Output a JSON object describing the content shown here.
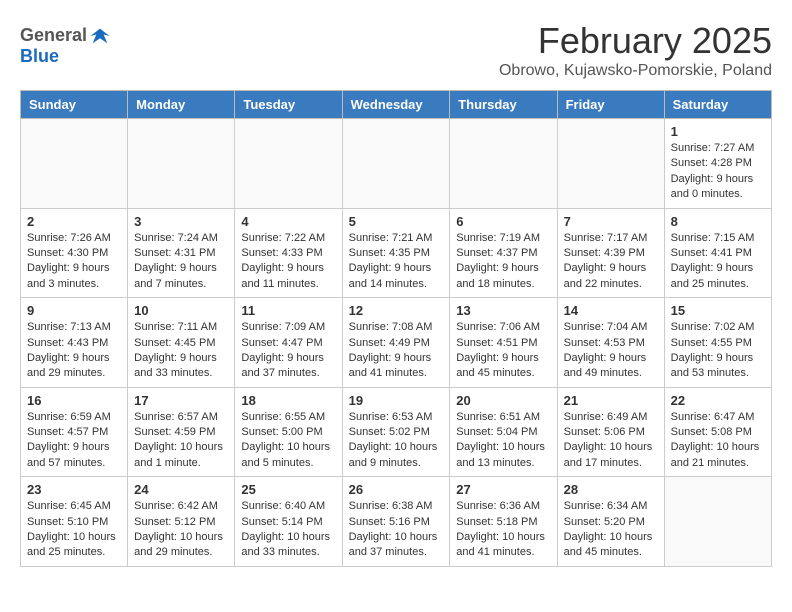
{
  "header": {
    "logo_general": "General",
    "logo_blue": "Blue",
    "title": "February 2025",
    "subtitle": "Obrowo, Kujawsko-Pomorskie, Poland"
  },
  "weekdays": [
    "Sunday",
    "Monday",
    "Tuesday",
    "Wednesday",
    "Thursday",
    "Friday",
    "Saturday"
  ],
  "weeks": [
    [
      {
        "day": "",
        "detail": ""
      },
      {
        "day": "",
        "detail": ""
      },
      {
        "day": "",
        "detail": ""
      },
      {
        "day": "",
        "detail": ""
      },
      {
        "day": "",
        "detail": ""
      },
      {
        "day": "",
        "detail": ""
      },
      {
        "day": "1",
        "detail": "Sunrise: 7:27 AM\nSunset: 4:28 PM\nDaylight: 9 hours and 0 minutes."
      }
    ],
    [
      {
        "day": "2",
        "detail": "Sunrise: 7:26 AM\nSunset: 4:30 PM\nDaylight: 9 hours and 3 minutes."
      },
      {
        "day": "3",
        "detail": "Sunrise: 7:24 AM\nSunset: 4:31 PM\nDaylight: 9 hours and 7 minutes."
      },
      {
        "day": "4",
        "detail": "Sunrise: 7:22 AM\nSunset: 4:33 PM\nDaylight: 9 hours and 11 minutes."
      },
      {
        "day": "5",
        "detail": "Sunrise: 7:21 AM\nSunset: 4:35 PM\nDaylight: 9 hours and 14 minutes."
      },
      {
        "day": "6",
        "detail": "Sunrise: 7:19 AM\nSunset: 4:37 PM\nDaylight: 9 hours and 18 minutes."
      },
      {
        "day": "7",
        "detail": "Sunrise: 7:17 AM\nSunset: 4:39 PM\nDaylight: 9 hours and 22 minutes."
      },
      {
        "day": "8",
        "detail": "Sunrise: 7:15 AM\nSunset: 4:41 PM\nDaylight: 9 hours and 25 minutes."
      }
    ],
    [
      {
        "day": "9",
        "detail": "Sunrise: 7:13 AM\nSunset: 4:43 PM\nDaylight: 9 hours and 29 minutes."
      },
      {
        "day": "10",
        "detail": "Sunrise: 7:11 AM\nSunset: 4:45 PM\nDaylight: 9 hours and 33 minutes."
      },
      {
        "day": "11",
        "detail": "Sunrise: 7:09 AM\nSunset: 4:47 PM\nDaylight: 9 hours and 37 minutes."
      },
      {
        "day": "12",
        "detail": "Sunrise: 7:08 AM\nSunset: 4:49 PM\nDaylight: 9 hours and 41 minutes."
      },
      {
        "day": "13",
        "detail": "Sunrise: 7:06 AM\nSunset: 4:51 PM\nDaylight: 9 hours and 45 minutes."
      },
      {
        "day": "14",
        "detail": "Sunrise: 7:04 AM\nSunset: 4:53 PM\nDaylight: 9 hours and 49 minutes."
      },
      {
        "day": "15",
        "detail": "Sunrise: 7:02 AM\nSunset: 4:55 PM\nDaylight: 9 hours and 53 minutes."
      }
    ],
    [
      {
        "day": "16",
        "detail": "Sunrise: 6:59 AM\nSunset: 4:57 PM\nDaylight: 9 hours and 57 minutes."
      },
      {
        "day": "17",
        "detail": "Sunrise: 6:57 AM\nSunset: 4:59 PM\nDaylight: 10 hours and 1 minute."
      },
      {
        "day": "18",
        "detail": "Sunrise: 6:55 AM\nSunset: 5:00 PM\nDaylight: 10 hours and 5 minutes."
      },
      {
        "day": "19",
        "detail": "Sunrise: 6:53 AM\nSunset: 5:02 PM\nDaylight: 10 hours and 9 minutes."
      },
      {
        "day": "20",
        "detail": "Sunrise: 6:51 AM\nSunset: 5:04 PM\nDaylight: 10 hours and 13 minutes."
      },
      {
        "day": "21",
        "detail": "Sunrise: 6:49 AM\nSunset: 5:06 PM\nDaylight: 10 hours and 17 minutes."
      },
      {
        "day": "22",
        "detail": "Sunrise: 6:47 AM\nSunset: 5:08 PM\nDaylight: 10 hours and 21 minutes."
      }
    ],
    [
      {
        "day": "23",
        "detail": "Sunrise: 6:45 AM\nSunset: 5:10 PM\nDaylight: 10 hours and 25 minutes."
      },
      {
        "day": "24",
        "detail": "Sunrise: 6:42 AM\nSunset: 5:12 PM\nDaylight: 10 hours and 29 minutes."
      },
      {
        "day": "25",
        "detail": "Sunrise: 6:40 AM\nSunset: 5:14 PM\nDaylight: 10 hours and 33 minutes."
      },
      {
        "day": "26",
        "detail": "Sunrise: 6:38 AM\nSunset: 5:16 PM\nDaylight: 10 hours and 37 minutes."
      },
      {
        "day": "27",
        "detail": "Sunrise: 6:36 AM\nSunset: 5:18 PM\nDaylight: 10 hours and 41 minutes."
      },
      {
        "day": "28",
        "detail": "Sunrise: 6:34 AM\nSunset: 5:20 PM\nDaylight: 10 hours and 45 minutes."
      },
      {
        "day": "",
        "detail": ""
      }
    ]
  ]
}
